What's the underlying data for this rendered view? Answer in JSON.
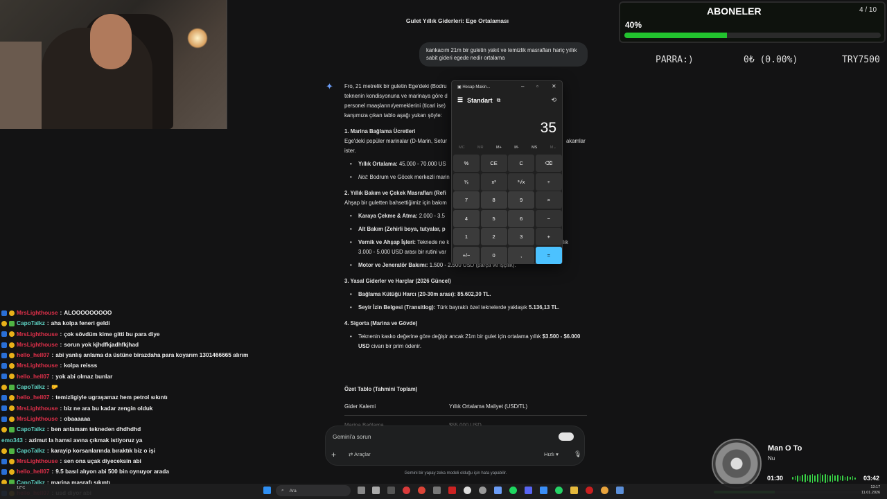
{
  "browser": {
    "page_title": "Gulet Yıllık Giderleri: Ege Ortalaması",
    "user_message": "kankacım 21m bir guletin yakıt ve temizlik masrafları hariç yıllık sabit gideri egede nedir ortalama",
    "answer": {
      "intro_1": "Fro, 21 metrelik bir guletin Ege'deki (Bodru",
      "intro_1_end": "),",
      "intro_2": "teknenin kondisyonuna ve marinaya göre d",
      "intro_2_end": "e",
      "intro_3": "personel maaşlarını/yemeklerini (ticari ise)",
      "intro_4": "karşımıza çıkan tablo aşağı yukarı şöyle:",
      "s1_heading": "1. Marina Bağlama Ücretleri",
      "s1_text": "Ege'deki popüler marinalar (D-Marin, Setur",
      "s1_text_end": "akamlar",
      "s1_text_2": "ister.",
      "s1_b1_label": "Yıllık Ortalama:",
      "s1_b1_value": "45.000 - 70.000 US",
      "s1_b2_label": "Not:",
      "s1_b2_value": "Bodrum ve Göcek merkezli marin",
      "s2_heading": "2. Yıllık Bakım ve Çekek Masrafları (Refi",
      "s2_text": "Ahşap bir guletten bahsettiğimiz için bakım",
      "s2_b1_label": "Karaya Çekme & Atma:",
      "s2_b1_value": "2.000 - 3.5",
      "s2_b2_label": "Alt Bakım (Zehirli boya, tutyalar, p",
      "s2_b3_label": "Vernik ve Ahşap İşleri:",
      "s2_b3_value": "Teknede ne k",
      "s2_b3_value_end": "k yıllık",
      "s2_b3_line2": "3.000 - 5.000 USD arası bir rutini var",
      "s2_b4_label": "Motor ve Jeneratör Bakımı:",
      "s2_b4_value": "1.500 - 2.500 USD (parça ve işçilik).",
      "s3_heading": "3. Yasal Giderler ve Harçlar (2026 Güncel)",
      "s3_b1_label": "Bağlama Kütüğü Harcı (20-30m arası):",
      "s3_b1_value": "85.602,30 TL.",
      "s3_b2_label": "Seyir İzin Belgesi (Transitlog):",
      "s3_b2_value": "Türk bayraklı özel teknelerde yaklaşık",
      "s3_b2_value_bold": "5.136,13 TL.",
      "s4_heading": "4. Sigorta (Marina ve Gövde)",
      "s4_b1_text": "Teknenin kasko değerine göre değişir ancak 21m bir gulet için ortalama yıllık",
      "s4_b1_bold": "$3.500 - $6.000 USD",
      "s4_b1_end": "civarı bir prim ödenir."
    },
    "summary": {
      "heading": "Özet Tablo (Tahmini Toplam)",
      "col_1": "Gider Kalemi",
      "col_2": "Yıllık Ortalama Maliyet (USD/TL)",
      "row_1_item": "Marina Bağlama",
      "row_1_cost": "$55.000 USD"
    },
    "prompt": {
      "placeholder": "Gemini'a sorun",
      "tools_label": "Araçlar",
      "mode_label": "Hızlı",
      "disclaimer": "Gemini bir yapay zeka modeli olduğu için hata yapabilir."
    }
  },
  "calculator": {
    "window_title": "Hesap Makin...",
    "mode": "Standart",
    "display": "35",
    "memory_keys": [
      {
        "label": "MC",
        "enabled": false
      },
      {
        "label": "MR",
        "enabled": false
      },
      {
        "label": "M+",
        "enabled": true
      },
      {
        "label": "M-",
        "enabled": true
      },
      {
        "label": "MS",
        "enabled": true
      },
      {
        "label": "M⌄",
        "enabled": false
      }
    ],
    "keys": [
      "%",
      "CE",
      "C",
      "⌫",
      "¹⁄ₓ",
      "x²",
      "²√x",
      "÷",
      "7",
      "8",
      "9",
      "×",
      "4",
      "5",
      "6",
      "−",
      "1",
      "2",
      "3",
      "+",
      "+/−",
      "0",
      ",",
      "="
    ]
  },
  "overlay": {
    "subs_title": "ABONELER",
    "subs_count": "4 / 10",
    "subs_percent_label": "40%",
    "subs_progress": 0.4,
    "parra_label": "PARRA:)",
    "parra_value": "0₺ (0.00%)",
    "parra_goal": "TRY7500"
  },
  "music": {
    "title": "Man O To",
    "artist": "Nu",
    "elapsed": "01:30",
    "total": "03:42",
    "progress": 0.41
  },
  "chat": [
    {
      "user": "MrsLighthouse",
      "color": "red",
      "msg": "ALOOOOOOOOO",
      "badges": [
        "blue",
        "yellow"
      ]
    },
    {
      "user": "CapoTalkz",
      "color": "cyan",
      "msg": "aha kolpa feneri geldi",
      "badges": [
        "yellow",
        "green"
      ]
    },
    {
      "user": "MrsLighthouse",
      "color": "red",
      "msg": "çok sövdüm kime gitti bu para diye",
      "badges": [
        "blue",
        "yellow"
      ]
    },
    {
      "user": "MrsLighthouse",
      "color": "red",
      "msg": "sorun yok kjhdfkjadhfkjhad",
      "badges": [
        "blue",
        "yellow"
      ]
    },
    {
      "user": "hello_hell07",
      "color": "red",
      "msg": "abi yanlış anlama da üstüne birazdaha para koyarım 1301466665 alırım",
      "badges": [
        "blue",
        "yellow"
      ]
    },
    {
      "user": "MrsLighthouse",
      "color": "red",
      "msg": "kolpa reisss",
      "badges": [
        "blue",
        "yellow"
      ]
    },
    {
      "user": "hello_hell07",
      "color": "red",
      "msg": "yok abi olmaz bunlar",
      "badges": [
        "blue",
        "yellow"
      ]
    },
    {
      "user": "CapoTalkz",
      "color": "cyan",
      "msg": "🤛",
      "badges": [
        "yellow",
        "green"
      ]
    },
    {
      "user": "hello_hell07",
      "color": "red",
      "msg": "temizligiyle ugraşamaz hem petrol sıkıntı",
      "badges": [
        "blue",
        "yellow"
      ]
    },
    {
      "user": "MrsLighthouse",
      "color": "red",
      "msg": "biz ne ara bu kadar zengin olduk",
      "badges": [
        "blue",
        "yellow"
      ]
    },
    {
      "user": "MrsLighthouse",
      "color": "red",
      "msg": "obaaaaaa",
      "badges": [
        "blue",
        "yellow"
      ]
    },
    {
      "user": "CapoTalkz",
      "color": "cyan",
      "msg": "ben anlamam tekneden dhdhdhd",
      "badges": [
        "yellow",
        "green"
      ]
    },
    {
      "user": "emo343",
      "color": "cyan",
      "msg": "azimut la hamsi avına çıkmak istiyoruz ya",
      "badges": []
    },
    {
      "user": "CapoTalkz",
      "color": "cyan",
      "msg": "karayip korsanlarında bıraktık biz o işi",
      "badges": [
        "yellow",
        "green"
      ]
    },
    {
      "user": "MrsLighthouse",
      "color": "red",
      "msg": "sen ona uçak diyeceksin abi",
      "badges": [
        "blue",
        "yellow"
      ]
    },
    {
      "user": "hello_hell07",
      "color": "red",
      "msg": "9.5 basıl alıyon abi 500 bin oynuyor arada",
      "badges": [
        "blue",
        "yellow"
      ]
    },
    {
      "user": "CapoTalkz",
      "color": "cyan",
      "msg": "marina masrafı sıkıntı",
      "badges": [
        "yellow",
        "green"
      ]
    },
    {
      "user": "hello_hell07",
      "color": "red",
      "msg": "usd diyor abi",
      "badges": [
        "blue",
        "yellow"
      ]
    }
  ],
  "taskbar": {
    "weather": "12°C",
    "search_label": "Ara",
    "clock_time": "13:17",
    "clock_date": "11.01.2026"
  },
  "colors": {
    "accent_green": "#22c32e",
    "calc_equals": "#4cc2ff",
    "gemini_blue": "#6b9cf5"
  }
}
